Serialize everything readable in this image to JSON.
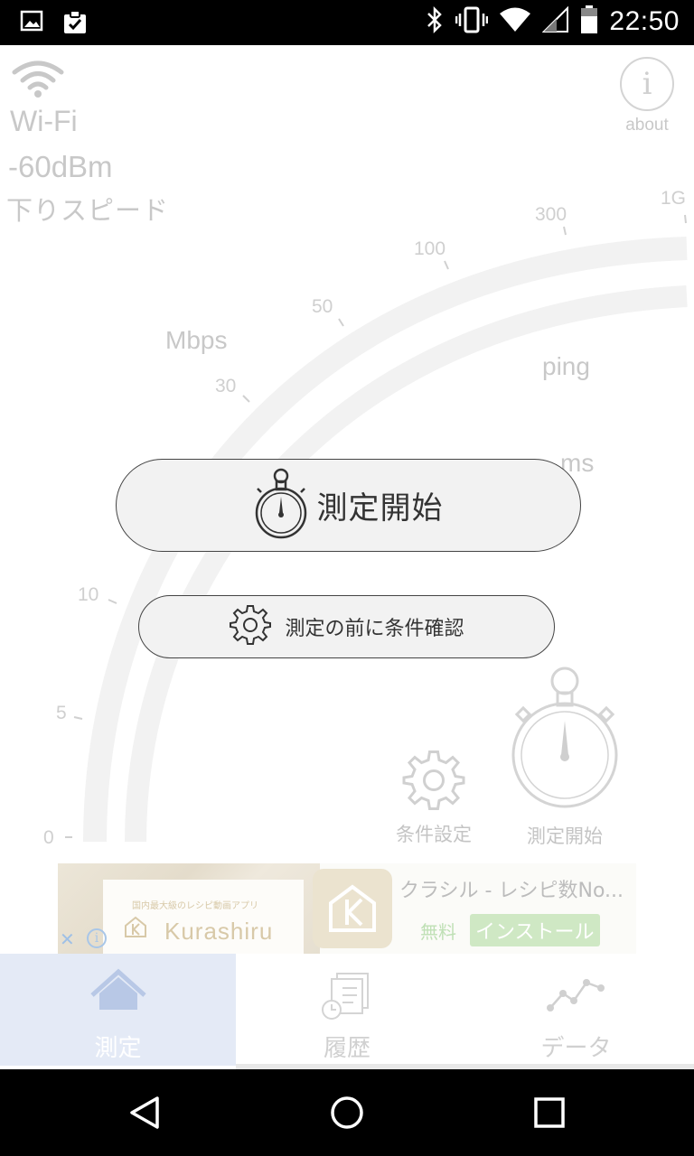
{
  "status_bar": {
    "time": "22:50",
    "left_icons": [
      "image-icon",
      "clipboard-check-icon"
    ],
    "right_icons": [
      "bluetooth-icon",
      "vibrate-icon",
      "wifi-icon",
      "cell-signal-icon",
      "battery-icon"
    ]
  },
  "connection": {
    "type": "Wi-Fi",
    "signal": "-60dBm",
    "direction": "下りスピード"
  },
  "about": {
    "label": "about",
    "icon": "i"
  },
  "gauge": {
    "scale_labels": [
      "0",
      "5",
      "10",
      "30",
      "50",
      "100",
      "300",
      "1G"
    ],
    "unit": "Mbps",
    "ping_label": "ping",
    "ping_unit": "ms"
  },
  "buttons": {
    "start_label": "測定開始",
    "conditions_label": "測定の前に条件確認"
  },
  "shortcuts": {
    "conditions_label": "条件設定",
    "start_label": "測定開始"
  },
  "ad": {
    "app_tag": "国内最大級のレシピ動画アプリ",
    "brand": "Kurashiru",
    "title": "クラシル - レシピ数No...",
    "free": "無料",
    "install": "インストール",
    "close": "✕",
    "info": "i"
  },
  "tabs": [
    {
      "label": "測定",
      "icon": "home-icon",
      "active": true
    },
    {
      "label": "履歴",
      "icon": "history-icon",
      "active": false
    },
    {
      "label": "データ",
      "icon": "chart-line-icon",
      "active": false
    }
  ],
  "nav": [
    "back-icon",
    "home-circle-icon",
    "recents-icon"
  ],
  "colors": {
    "active_tab_bg": "#e4eaf6",
    "active_tab_icon": "#b8c8e6",
    "faded_text": "#c8c8c8",
    "install_bg": "#cfe8c4"
  }
}
